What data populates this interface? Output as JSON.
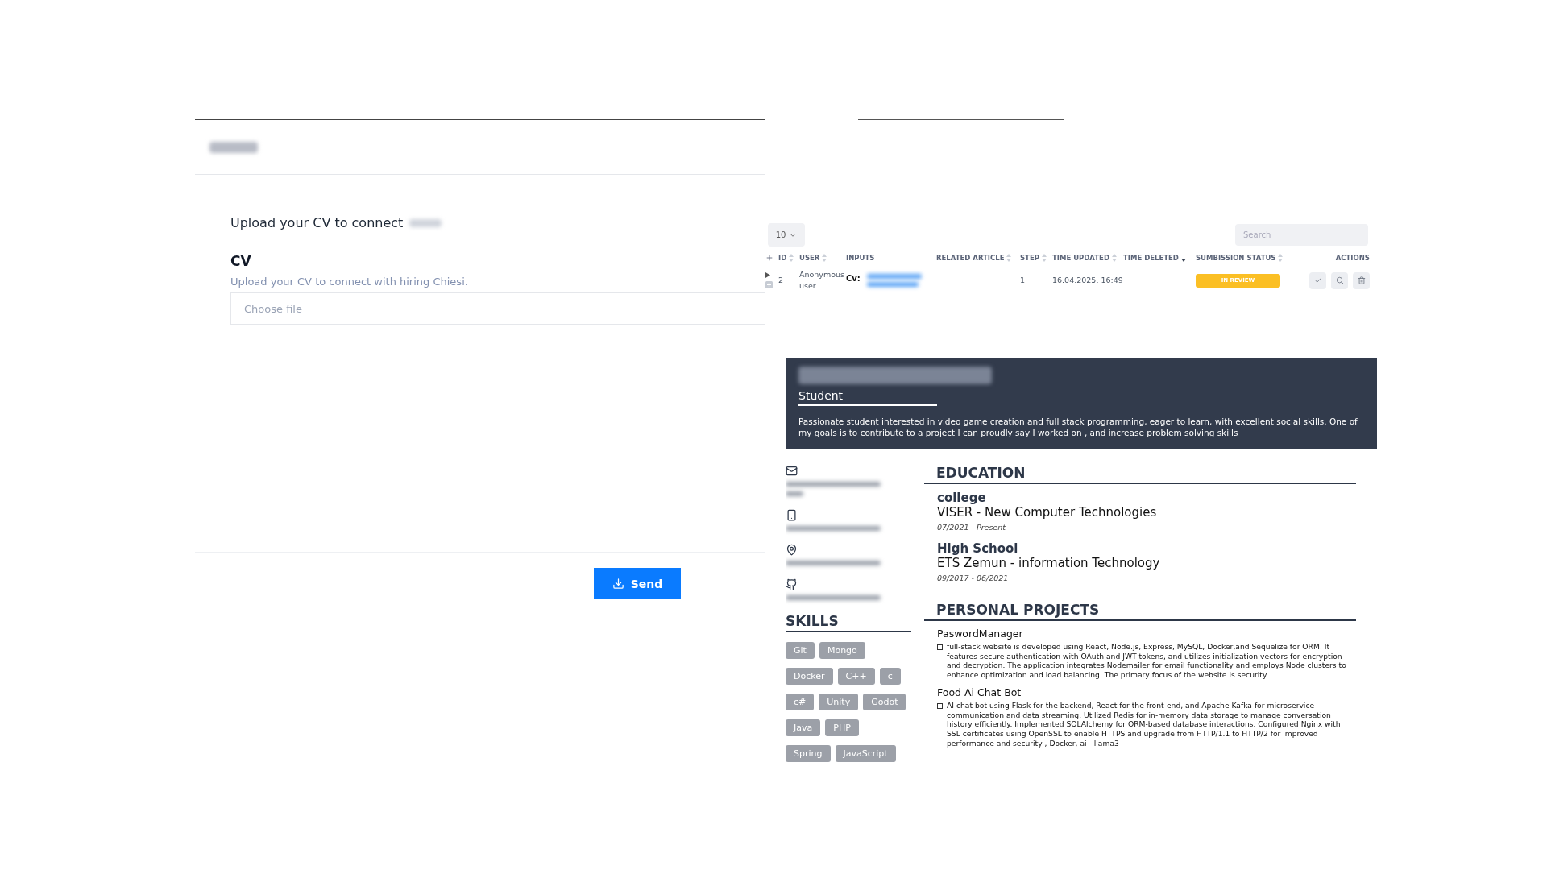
{
  "form": {
    "intro": "Upload your CV to connect",
    "field_label": "CV",
    "hint": "Upload your CV to connect with hiring Chiesi.",
    "file_field": {
      "placeholder": "Choose file"
    },
    "submit": "Send"
  },
  "table": {
    "page_size": "10",
    "search": {
      "placeholder": "Search"
    },
    "columns": [
      {
        "label": "ID",
        "sortable": true,
        "sorted": false
      },
      {
        "label": "USER",
        "sortable": true,
        "sorted": false
      },
      {
        "label": "INPUTS",
        "sortable": false,
        "sorted": false
      },
      {
        "label": "RELATED ARTICLE",
        "sortable": true,
        "sorted": false
      },
      {
        "label": "STEP",
        "sortable": true,
        "sorted": false
      },
      {
        "label": "TIME UPDATED",
        "sortable": true,
        "sorted": false
      },
      {
        "label": "TIME DELETED",
        "sortable": true,
        "sorted": true
      },
      {
        "label": "SUMBISSION STATUS",
        "sortable": true,
        "sorted": false
      },
      {
        "label": "ACTIONS",
        "sortable": false,
        "sorted": false
      }
    ],
    "rows": [
      {
        "id": "2",
        "user": "Anonymous user",
        "input_label": "Cv:",
        "step": "1",
        "time_updated": "16.04.2025. 16:49",
        "status": "IN REVIEW",
        "color": "#fbbf24"
      }
    ]
  },
  "resume": {
    "title": "Student",
    "summary": "Passionate student interested in video game creation and full stack programming, eager to learn, with excellent social skills. One of my goals is to contribute to a project I can proudly say I worked on , and increase problem solving skills",
    "contacts": [
      {
        "kind": "mail"
      },
      {
        "kind": "phone"
      },
      {
        "kind": "pin"
      },
      {
        "kind": "github"
      }
    ],
    "skills_heading": "SKILLS",
    "skills": [
      [
        "Git",
        "Mongo"
      ],
      [
        "Docker",
        "C++",
        "c"
      ],
      [
        "c#",
        "Unity",
        "Godot"
      ],
      [
        "Java",
        "PHP"
      ],
      [
        "Spring",
        "JavaScript"
      ]
    ],
    "education_heading": "EDUCATION",
    "education": [
      {
        "level": "college",
        "school": "VISER - New Computer Technologies",
        "dates": "07/2021 - Present"
      },
      {
        "level": "High School",
        "school": "ETS Zemun - information Technology",
        "dates": "09/2017 - 06/2021"
      }
    ],
    "projects_heading": "PERSONAL PROJECTS",
    "projects": [
      {
        "name": "PaswordManager",
        "description": "full-stack website is developed using React, Node.js, Express, MySQL, Docker,and Sequelize for ORM. It features secure authentication with OAuth and JWT tokens, and utilizes initialization vectors for encryption and decryption. The application integrates Nodemailer for email functionality and employs Node clusters to enhance optimization and load balancing. The primary focus of the website is security"
      },
      {
        "name": "Food Ai Chat Bot",
        "description": "AI chat bot using Flask for the backend, React for the front-end, and Apache Kafka for microservice communication and data streaming. Utilized Redis for in-memory data storage to manage conversation history efficiently. Implemented SQLAlchemy for ORM-based database interactions. Configured Nginx with SSL certificates using OpenSSL to enable HTTPS and upgrade from HTTP/1.1 to HTTP/2 for improved performance and security , Docker, ai - llama3"
      }
    ]
  }
}
